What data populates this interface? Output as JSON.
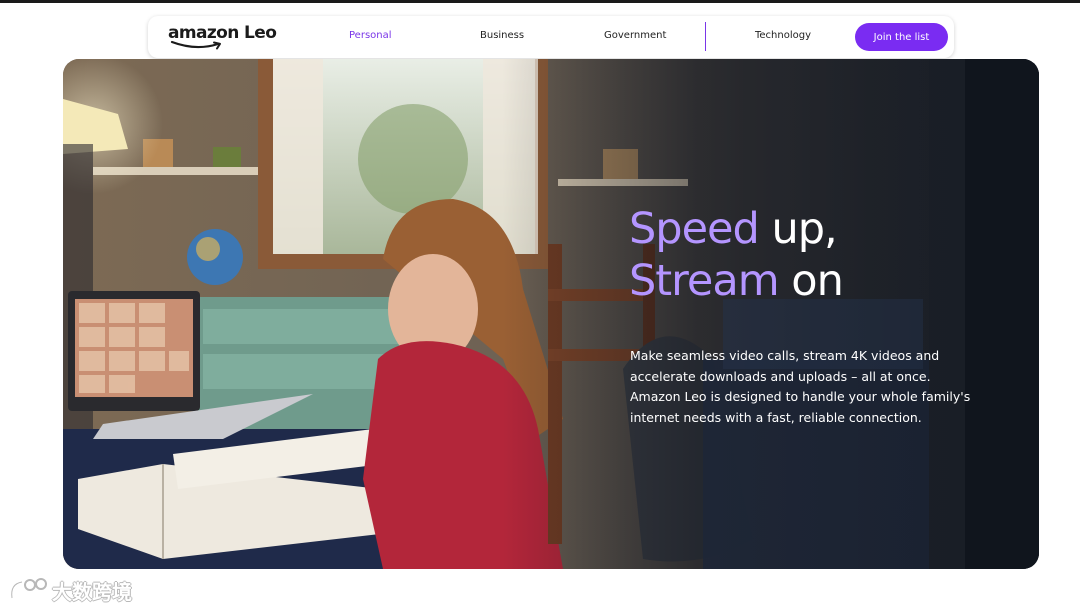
{
  "brand": {
    "logo_text": "amazon Leo"
  },
  "nav": {
    "items": [
      {
        "label": "Personal",
        "active": true
      },
      {
        "label": "Business",
        "active": false
      },
      {
        "label": "Government",
        "active": false
      },
      {
        "label": "Technology",
        "active": false
      }
    ],
    "cta_label": "Join the list"
  },
  "hero": {
    "headline_line1_accent": "Speed",
    "headline_line1_rest": " up,",
    "headline_line2_accent": "Stream",
    "headline_line2_rest": " on",
    "body": "Make seamless video calls, stream 4K videos and accelerate downloads and uploads – all at once. Amazon Leo is designed to handle your whole family's internet needs with a fast, reliable connection."
  },
  "watermark": {
    "text": "大数跨境"
  },
  "colors": {
    "accent": "#7a2cf2",
    "active_nav": "#7a36e8",
    "headline_accent": "#b495ff",
    "text_dark": "#222222"
  },
  "icons": [
    "amazon-smile-logo",
    "watermark-logo-icon"
  ]
}
